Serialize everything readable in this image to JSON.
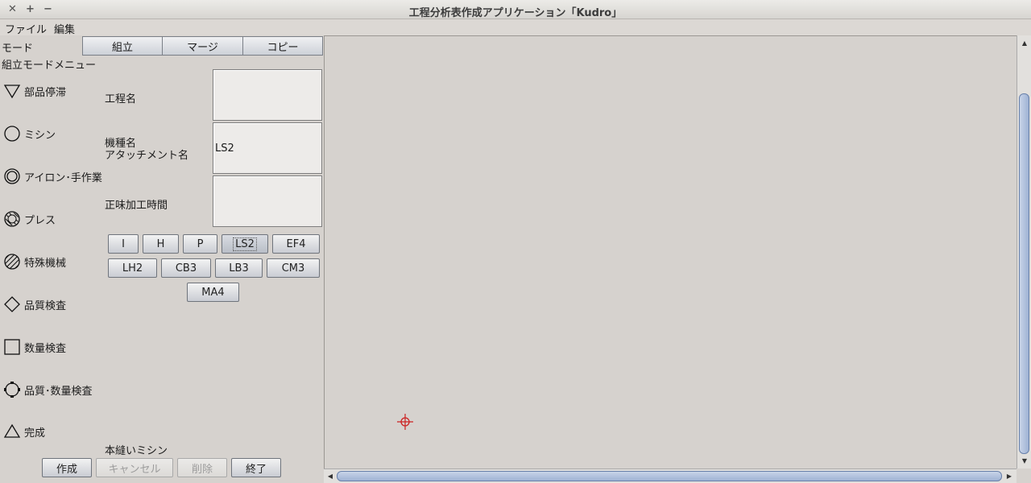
{
  "window": {
    "title": "工程分析表作成アプリケーション「Kudro」",
    "controls": [
      "✕",
      "+",
      "−"
    ]
  },
  "menu": {
    "file": "ファイル",
    "edit": "編集"
  },
  "mode": {
    "label": "モード",
    "buttons": [
      "組立",
      "マージ",
      "コピー"
    ]
  },
  "menu_title": "組立モードメニュー",
  "symbols": [
    {
      "icon": "inverted-triangle-icon",
      "label": "部品停滞"
    },
    {
      "icon": "circle-icon",
      "label": "ミシン"
    },
    {
      "icon": "double-circle-icon",
      "label": "アイロン･手作業"
    },
    {
      "icon": "hatched-circle-icon",
      "label": "プレス"
    },
    {
      "icon": "diagonal-hatched-circle-icon",
      "label": "特殊機械"
    },
    {
      "icon": "diamond-icon",
      "label": "品質検査"
    },
    {
      "icon": "square-icon",
      "label": "数量検査"
    },
    {
      "icon": "octagon-circle-icon",
      "label": "品質･数量検査"
    },
    {
      "icon": "triangle-icon",
      "label": "完成"
    }
  ],
  "fields": {
    "process_name_label": "工程名",
    "process_name_value": "",
    "machine_label_1": "機種名",
    "machine_label_2": "アタッチメント名",
    "machine_value": "LS2",
    "time_label": "正味加工時間",
    "time_value": ""
  },
  "machine_buttons": {
    "row1": [
      "I",
      "H",
      "P",
      "LS2",
      "EF4"
    ],
    "row2": [
      "LH2",
      "CB3",
      "LB3",
      "CM3"
    ],
    "row3": [
      "MA4"
    ],
    "selected": "LS2"
  },
  "status_text": "本縫いミシン",
  "actions": {
    "create": "作成",
    "cancel": "キャンセル",
    "delete": "削除",
    "exit": "終了"
  },
  "colors": {
    "crosshair": "#cc2222",
    "scroll_thumb": "#9fb2d4"
  }
}
